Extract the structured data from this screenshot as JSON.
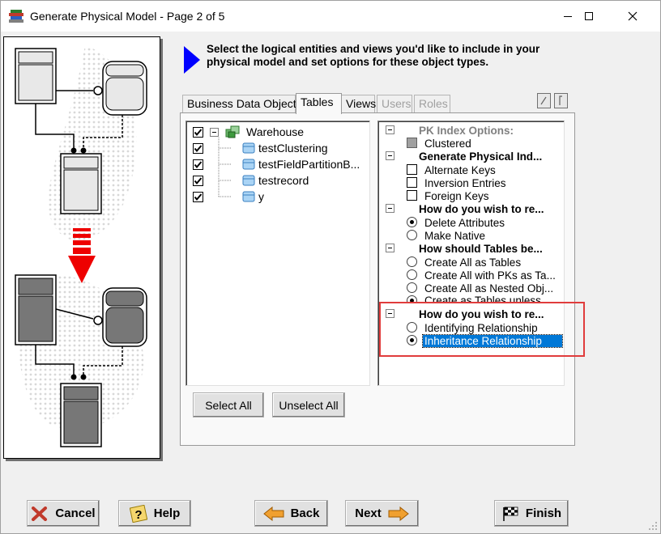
{
  "window": {
    "title": "Generate Physical Model - Page 2 of 5"
  },
  "instruction": "Select the logical entities and views you'd like to include in your physical model and set options for these object types.",
  "tabs": [
    {
      "label": "Business Data Object",
      "state": "normal"
    },
    {
      "label": "Tables",
      "state": "active"
    },
    {
      "label": "Views",
      "state": "normal"
    },
    {
      "label": "Users",
      "state": "disabled"
    },
    {
      "label": "Roles",
      "state": "disabled"
    }
  ],
  "tree": {
    "root": {
      "label": "Warehouse",
      "checked": true
    },
    "children": [
      {
        "label": "testClustering",
        "checked": true
      },
      {
        "label": "testFieldPartitionB...",
        "checked": true
      },
      {
        "label": "testrecord",
        "checked": true
      },
      {
        "label": "y",
        "checked": true
      }
    ]
  },
  "options": {
    "groups": [
      {
        "header": "PK Index Options:",
        "header_disabled": true,
        "items": [
          {
            "label": "Clustered",
            "kind": "check",
            "checked": false,
            "disabled": true
          }
        ]
      },
      {
        "header": "Generate Physical Ind...",
        "items": [
          {
            "label": "Alternate Keys",
            "kind": "check",
            "checked": false
          },
          {
            "label": "Inversion Entries",
            "kind": "check",
            "checked": false
          },
          {
            "label": "Foreign Keys",
            "kind": "check",
            "checked": false
          }
        ]
      },
      {
        "header": "How do you wish to re...",
        "items": [
          {
            "label": "Delete Attributes",
            "kind": "radio",
            "checked": true
          },
          {
            "label": "Make Native",
            "kind": "radio",
            "checked": false
          }
        ]
      },
      {
        "header": "How should Tables be...",
        "items": [
          {
            "label": "Create All as Tables",
            "kind": "radio",
            "checked": false
          },
          {
            "label": "Create All with PKs as Ta...",
            "kind": "radio",
            "checked": false
          },
          {
            "label": "Create All as Nested Obj...",
            "kind": "radio",
            "checked": false
          },
          {
            "label": "Create as Tables unless ...",
            "kind": "radio",
            "checked": true
          }
        ]
      },
      {
        "header": "How do you wish to re...",
        "items": [
          {
            "label": "Identifying Relationship",
            "kind": "radio",
            "checked": false
          },
          {
            "label": "Inheritance Relationship",
            "kind": "radio",
            "checked": true,
            "selected": true
          }
        ]
      }
    ]
  },
  "buttons": {
    "select_all": "Select All",
    "unselect_all": "Unselect All",
    "cancel": "Cancel",
    "help": "Help",
    "back": "Back",
    "next": "Next",
    "finish": "Finish"
  },
  "colors": {
    "selection": "#0078d7",
    "highlight_box": "#e03c3c",
    "instruction_arrow": "#0000ff"
  }
}
